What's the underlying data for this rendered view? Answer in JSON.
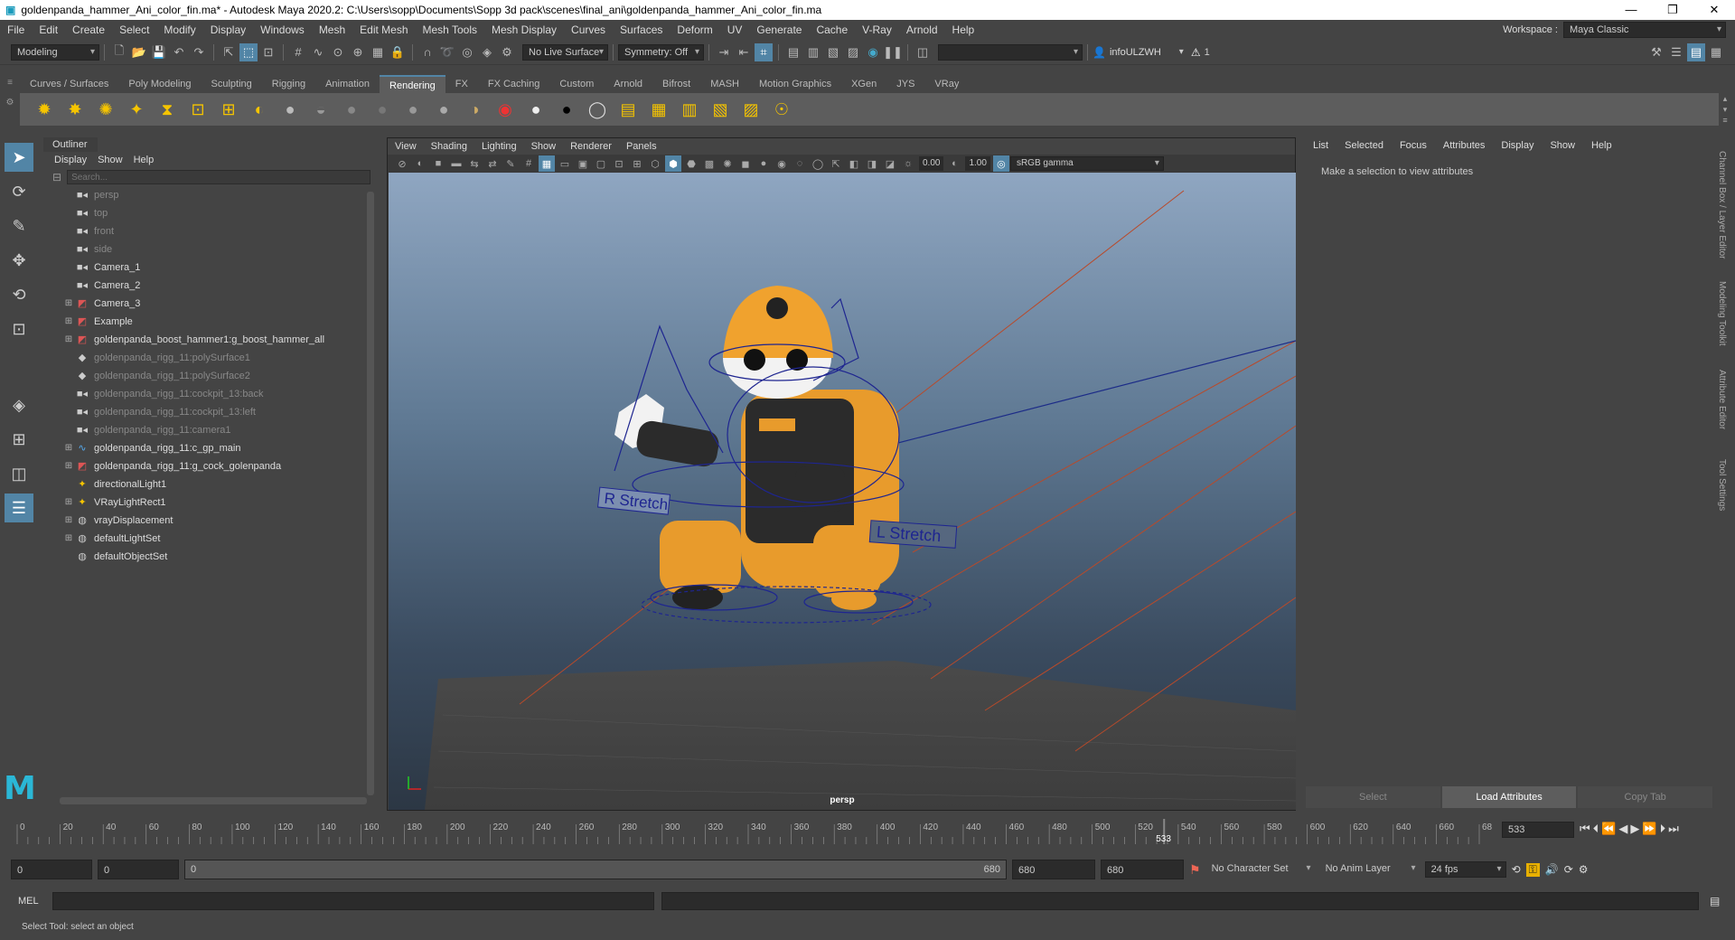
{
  "window": {
    "title": "goldenpanda_hammer_Ani_color_fin.ma* - Autodesk Maya 2020.2: C:\\Users\\sopp\\Documents\\Sopp 3d pack\\scenes\\final_ani\\goldenpanda_hammer_Ani_color_fin.ma"
  },
  "menus": [
    "File",
    "Edit",
    "Create",
    "Select",
    "Modify",
    "Display",
    "Windows",
    "Mesh",
    "Edit Mesh",
    "Mesh Tools",
    "Mesh Display",
    "Curves",
    "Surfaces",
    "Deform",
    "UV",
    "Generate",
    "Cache",
    "V-Ray",
    "Arnold",
    "Help"
  ],
  "workspace": {
    "label": "Workspace :",
    "value": "Maya Classic"
  },
  "status": {
    "menuset": "Modeling",
    "live_surface": "No Live Surface",
    "symmetry": "Symmetry: Off",
    "user": "infoULZWH",
    "notifications": "1"
  },
  "shelf_tabs": [
    "Curves / Surfaces",
    "Poly Modeling",
    "Sculpting",
    "Rigging",
    "Animation",
    "Rendering",
    "FX",
    "FX Caching",
    "Custom",
    "Arnold",
    "Bifrost",
    "MASH",
    "Motion Graphics",
    "XGen",
    "JYS",
    "VRay"
  ],
  "shelf_active": "Rendering",
  "outliner": {
    "title": "Outliner",
    "menu": [
      "Display",
      "Show",
      "Help"
    ],
    "search_placeholder": "Search...",
    "items": [
      {
        "label": "persp",
        "dim": true,
        "expand": false,
        "icon": "camera-icon"
      },
      {
        "label": "top",
        "dim": true,
        "expand": false,
        "icon": "camera-icon"
      },
      {
        "label": "front",
        "dim": true,
        "expand": false,
        "icon": "camera-icon"
      },
      {
        "label": "side",
        "dim": true,
        "expand": false,
        "icon": "camera-icon"
      },
      {
        "label": "Camera_1",
        "dim": false,
        "expand": false,
        "icon": "camera-icon"
      },
      {
        "label": "Camera_2",
        "dim": false,
        "expand": false,
        "icon": "camera-icon"
      },
      {
        "label": "Camera_3",
        "dim": false,
        "expand": true,
        "icon": "group-icon"
      },
      {
        "label": "Example",
        "dim": false,
        "expand": true,
        "icon": "group-icon"
      },
      {
        "label": "goldenpanda_boost_hammer1:g_boost_hammer_all",
        "dim": false,
        "expand": true,
        "icon": "group-icon"
      },
      {
        "label": "goldenpanda_rigg_11:polySurface1",
        "dim": true,
        "expand": false,
        "icon": "mesh-icon"
      },
      {
        "label": "goldenpanda_rigg_11:polySurface2",
        "dim": true,
        "expand": false,
        "icon": "mesh-icon"
      },
      {
        "label": "goldenpanda_rigg_11:cockpit_13:back",
        "dim": true,
        "expand": false,
        "icon": "camera-icon"
      },
      {
        "label": "goldenpanda_rigg_11:cockpit_13:left",
        "dim": true,
        "expand": false,
        "icon": "camera-icon"
      },
      {
        "label": "goldenpanda_rigg_11:camera1",
        "dim": true,
        "expand": false,
        "icon": "camera-icon"
      },
      {
        "label": "goldenpanda_rigg_11:c_gp_main",
        "dim": false,
        "expand": true,
        "icon": "curve-icon"
      },
      {
        "label": "goldenpanda_rigg_11:g_cock_golenpanda",
        "dim": false,
        "expand": true,
        "icon": "group-icon"
      },
      {
        "label": "directionalLight1",
        "dim": false,
        "expand": false,
        "icon": "light-icon"
      },
      {
        "label": "VRayLightRect1",
        "dim": false,
        "expand": true,
        "icon": "light-icon"
      },
      {
        "label": "vrayDisplacement",
        "dim": false,
        "expand": true,
        "icon": "set-icon"
      },
      {
        "label": "defaultLightSet",
        "dim": false,
        "expand": true,
        "icon": "set-icon"
      },
      {
        "label": "defaultObjectSet",
        "dim": false,
        "expand": false,
        "icon": "set-icon"
      }
    ]
  },
  "viewport": {
    "menu": [
      "View",
      "Shading",
      "Lighting",
      "Show",
      "Renderer",
      "Panels"
    ],
    "near": "0.00",
    "far": "1.00",
    "color_space": "sRGB gamma",
    "camera_label": "persp",
    "labels": {
      "r_stretch": "R Stretch",
      "l_stretch": "L Stretch"
    }
  },
  "attribute_editor": {
    "menu": [
      "List",
      "Selected",
      "Focus",
      "Attributes",
      "Display",
      "Show",
      "Help"
    ],
    "message": "Make a selection to view attributes",
    "buttons": [
      "Select",
      "Load Attributes",
      "Copy Tab"
    ]
  },
  "side_tabs": [
    "Channel Box / Layer Editor",
    "Modeling Toolkit",
    "Attribute Editor",
    "Tool Settings"
  ],
  "timeline": {
    "ticks": [
      "0",
      "20",
      "40",
      "60",
      "80",
      "100",
      "120",
      "140",
      "160",
      "180",
      "200",
      "220",
      "240",
      "260",
      "280",
      "300",
      "320",
      "340",
      "360",
      "380",
      "400",
      "420",
      "440",
      "460",
      "480",
      "500",
      "520",
      "540",
      "560",
      "580",
      "600",
      "620",
      "640",
      "660",
      "68"
    ],
    "current_frame": "533",
    "current_frame_field": "533",
    "max_frame": 680
  },
  "range": {
    "start": "0",
    "inner_start": "0",
    "slider_start": "0",
    "slider_end": "680",
    "end": "680",
    "outer_end": "680",
    "character_set": "No Character Set",
    "anim_layer": "No Anim Layer",
    "fps": "24 fps"
  },
  "command": {
    "lang": "MEL"
  },
  "help_line": "Select Tool: select an object"
}
